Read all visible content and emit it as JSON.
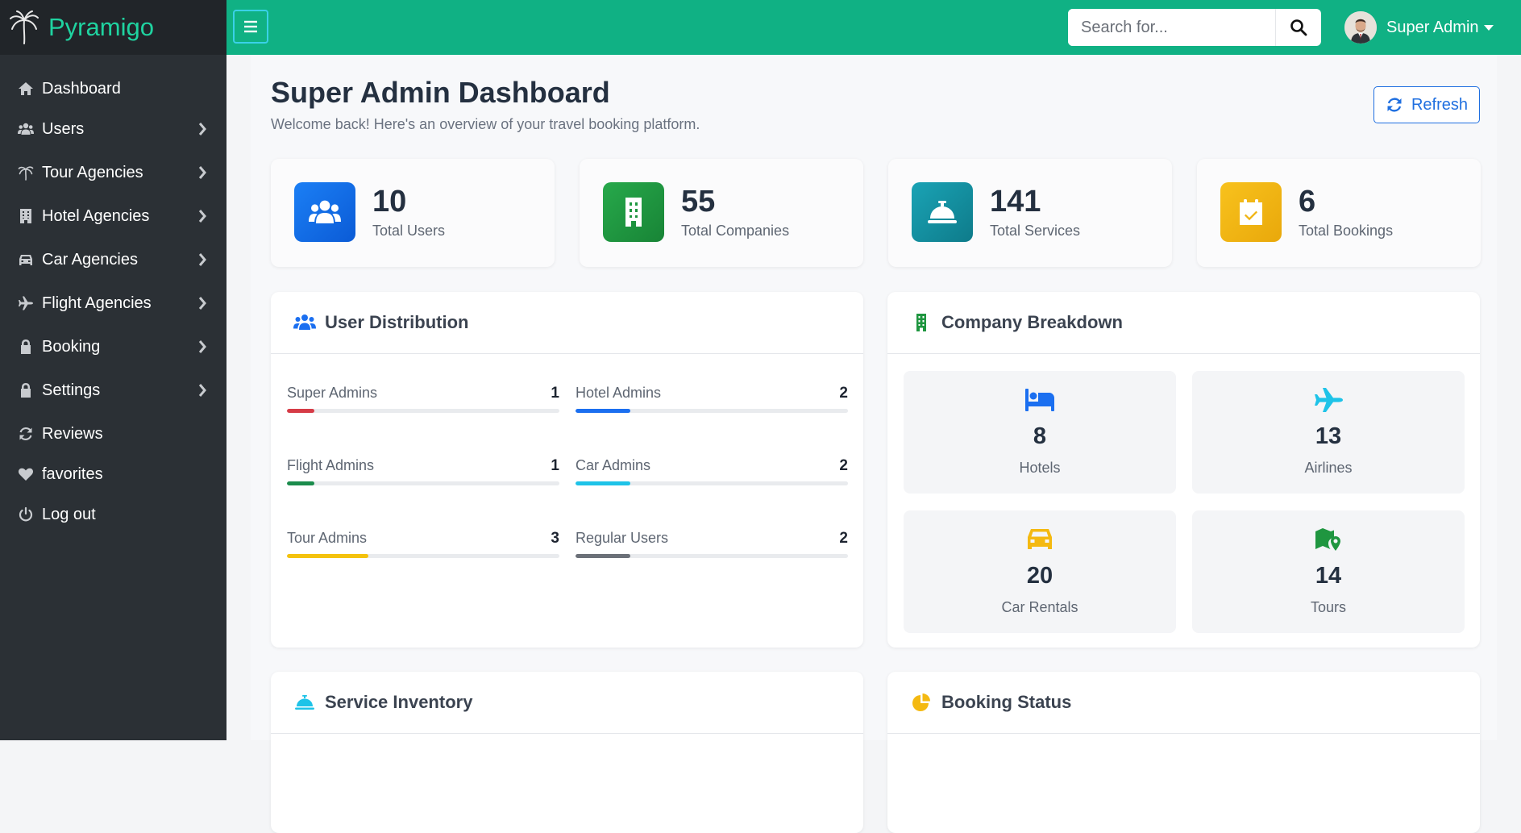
{
  "brand": {
    "name": "Pyramigo"
  },
  "sidebar": {
    "items": [
      {
        "label": "Dashboard",
        "icon": "home-icon",
        "has_submenu": false
      },
      {
        "label": "Users",
        "icon": "users-icon",
        "has_submenu": true
      },
      {
        "label": "Tour Agencies",
        "icon": "palm-tree-icon",
        "has_submenu": true
      },
      {
        "label": "Hotel Agencies",
        "icon": "building-icon",
        "has_submenu": true
      },
      {
        "label": "Car Agencies",
        "icon": "car-icon",
        "has_submenu": true
      },
      {
        "label": "Flight Agencies",
        "icon": "plane-icon",
        "has_submenu": true
      },
      {
        "label": "Booking",
        "icon": "lock-icon",
        "has_submenu": true
      },
      {
        "label": "Settings",
        "icon": "lock-icon",
        "has_submenu": true
      },
      {
        "label": "Reviews",
        "icon": "sync-icon",
        "has_submenu": false
      },
      {
        "label": "favorites",
        "icon": "heart-icon",
        "has_submenu": false
      },
      {
        "label": "Log out",
        "icon": "power-icon",
        "has_submenu": false
      }
    ]
  },
  "topbar": {
    "search_placeholder": "Search for...",
    "user_name": "Super Admin"
  },
  "header": {
    "title": "Super Admin Dashboard",
    "subtitle": "Welcome back! Here's an overview of your travel booking platform.",
    "refresh_label": "Refresh"
  },
  "stats": [
    {
      "value": "10",
      "label": "Total Users",
      "icon": "users-icon",
      "color": "#1673f0"
    },
    {
      "value": "55",
      "label": "Total Companies",
      "icon": "building-icon",
      "color": "#1f9640"
    },
    {
      "value": "141",
      "label": "Total Services",
      "icon": "concierge-bell-icon",
      "color": "#13899c"
    },
    {
      "value": "6",
      "label": "Total Bookings",
      "icon": "calendar-check-icon",
      "color": "#f4b911"
    }
  ],
  "user_distribution": {
    "title": "User Distribution",
    "items": [
      {
        "label": "Super Admins",
        "value": "1",
        "fraction": 0.1,
        "color": "#d63b46"
      },
      {
        "label": "Hotel Admins",
        "value": "2",
        "fraction": 0.2,
        "color": "#1b6ff0"
      },
      {
        "label": "Flight Admins",
        "value": "1",
        "fraction": 0.1,
        "color": "#1b8c4c"
      },
      {
        "label": "Car Admins",
        "value": "2",
        "fraction": 0.2,
        "color": "#1ec3e8"
      },
      {
        "label": "Tour Admins",
        "value": "3",
        "fraction": 0.3,
        "color": "#f4c20d"
      },
      {
        "label": "Regular Users",
        "value": "2",
        "fraction": 0.2,
        "color": "#6b7078"
      }
    ]
  },
  "company_breakdown": {
    "title": "Company Breakdown",
    "items": [
      {
        "value": "8",
        "label": "Hotels",
        "icon": "bed-icon",
        "color": "#1b6ff0"
      },
      {
        "value": "13",
        "label": "Airlines",
        "icon": "plane-icon",
        "color": "#1ec3e8"
      },
      {
        "value": "20",
        "label": "Car Rentals",
        "icon": "car-icon",
        "color": "#f4b911"
      },
      {
        "value": "14",
        "label": "Tours",
        "icon": "map-marker-icon",
        "color": "#1f9640"
      }
    ]
  },
  "service_inventory": {
    "title": "Service Inventory"
  },
  "booking_status": {
    "title": "Booking Status"
  }
}
